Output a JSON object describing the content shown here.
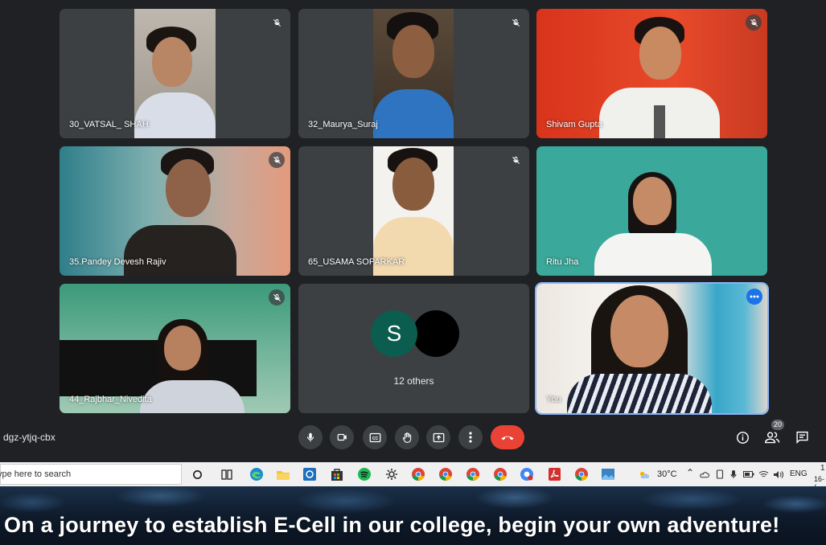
{
  "meeting": {
    "code": "dgz-ytjq-cbx",
    "participant_count": "20",
    "participants": [
      {
        "name": "30_VATSAL_ SHAH",
        "muted": true
      },
      {
        "name": "32_Maurya_Suraj",
        "muted": true
      },
      {
        "name": "Shivam Gupta",
        "muted": true
      },
      {
        "name": "35.Pandey Devesh Rajiv",
        "muted": true
      },
      {
        "name": "65_USAMA SOPARKAR",
        "muted": true
      },
      {
        "name": "Ritu Jha",
        "muted": false
      },
      {
        "name": "44_Rajbhar_Nivedita",
        "muted": true
      },
      {
        "name": "You",
        "muted": false,
        "active": true
      }
    ],
    "others": {
      "avatar_letter": "S",
      "label": "12 others"
    }
  },
  "controls": {
    "icons": [
      "mic-icon",
      "camera-icon",
      "captions-icon",
      "raise-hand-icon",
      "present-icon",
      "more-options-icon",
      "end-call-icon"
    ],
    "side_icons": [
      "info-icon",
      "people-icon",
      "chat-icon"
    ]
  },
  "taskbar": {
    "search_placeholder": "ype here to search",
    "weather": "30°C",
    "language": "ENG",
    "clock_partial_time": "1",
    "clock_partial_date": "16-("
  },
  "banner": {
    "text": "On a journey to establish E-Cell in our college, begin your own adventure!"
  },
  "colors": {
    "meet_bg": "#202124",
    "tile_bg": "#3c4043",
    "end_call": "#ea4335",
    "active_border": "#8ab4f8",
    "avatar_s": "#0b5d4f"
  }
}
